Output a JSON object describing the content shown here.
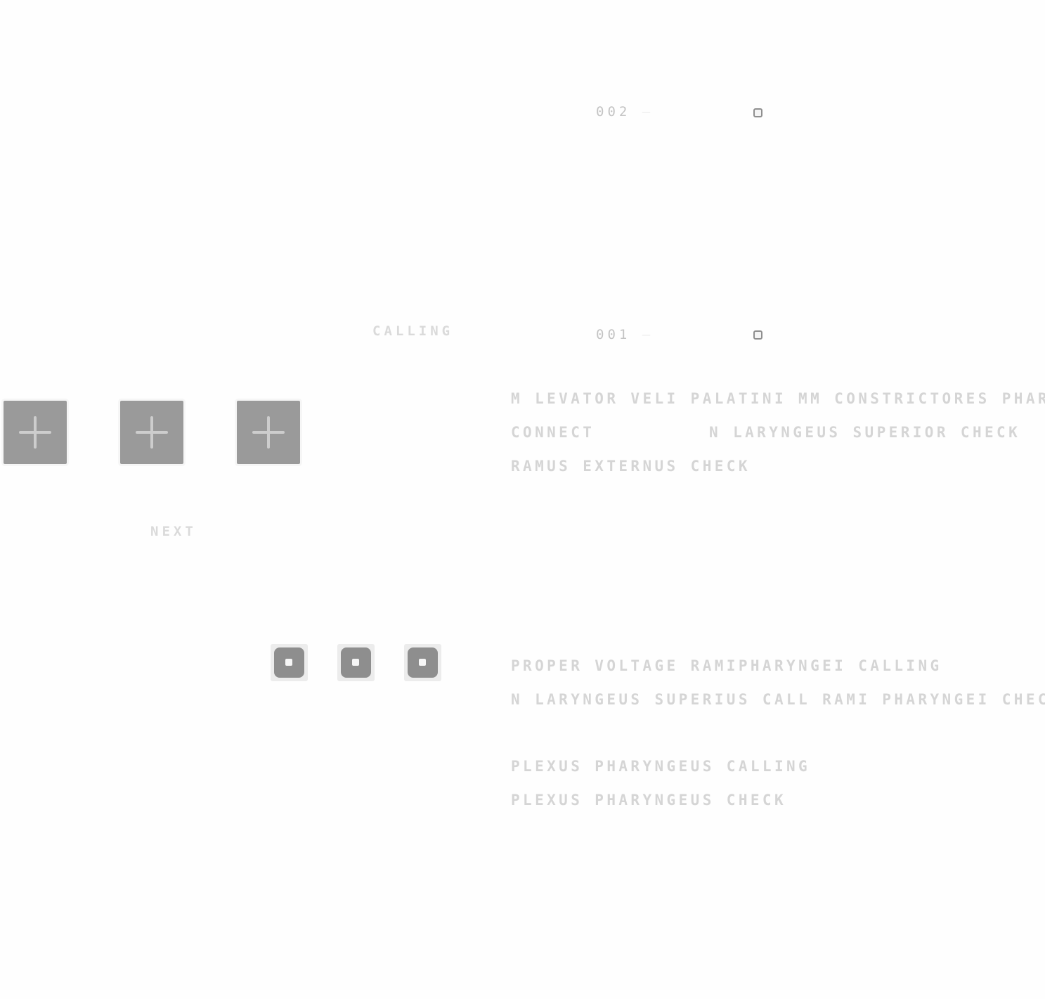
{
  "status": {
    "line_2": {
      "code": "002",
      "dash": "—",
      "indicator_icon": "square-outline-icon"
    },
    "line_1": {
      "code": "001",
      "dash": "—",
      "indicator_icon": "square-outline-icon"
    }
  },
  "labels": {
    "calling": "CALLING",
    "next": "NEXT"
  },
  "add_buttons": [
    {
      "icon": "plus-icon"
    },
    {
      "icon": "plus-icon"
    },
    {
      "icon": "plus-icon"
    }
  ],
  "dot_buttons": [
    {
      "icon": "dot-icon"
    },
    {
      "icon": "dot-icon"
    },
    {
      "icon": "dot-icon"
    }
  ],
  "group_upper": [
    "M LEVATOR VELI PALATINI MM CONSTRICTORES PHARYN",
    "CONNECT",
    "N LARYNGEUS SUPERIOR CHECK",
    "RAMUS EXTERNUS CHECK"
  ],
  "group_lower": [
    "PROPER VOLTAGE RAMIPHARYNGEI CALLING",
    "N LARYNGEUS SUPERIUS CALL RAMI PHARYNGEI CHECK",
    "PLEXUS PHARYNGEUS CALLING",
    "PLEXUS PHARYNGEUS CHECK"
  ]
}
